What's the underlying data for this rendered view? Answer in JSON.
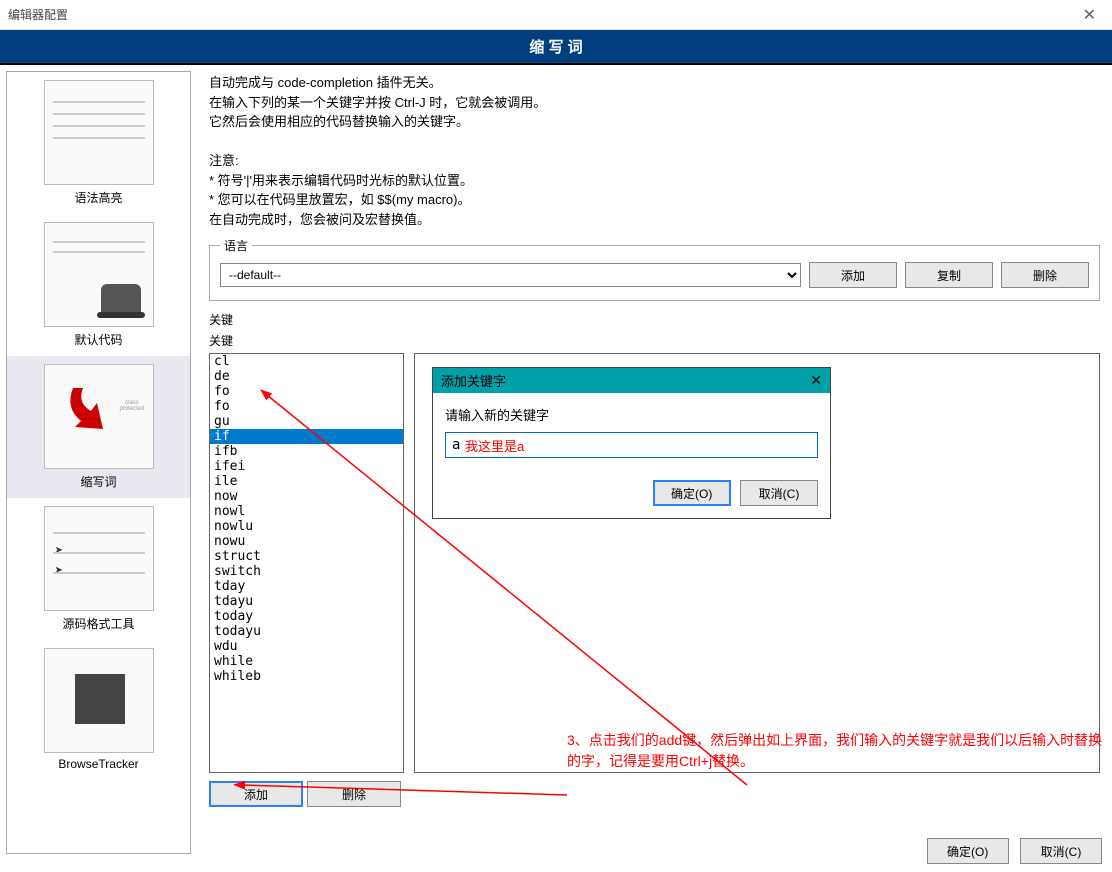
{
  "window": {
    "title": "编辑器配置"
  },
  "banner": "缩 写 词",
  "sidebar": {
    "items": [
      {
        "label": "语法高亮"
      },
      {
        "label": "默认代码"
      },
      {
        "label": "缩写词"
      },
      {
        "label": "源码格式工具"
      },
      {
        "label": "BrowseTracker"
      }
    ]
  },
  "description": {
    "line1": "自动完成与 code-completion 插件无关。",
    "line2": "在输入下列的某一个关键字并按 Ctrl-J 时，它就会被调用。",
    "line3": "它然后会使用相应的代码替换输入的关键字。",
    "note_h": "注意:",
    "note1": "* 符号'|'用来表示编辑代码时光标的默认位置。",
    "note2": "* 您可以在代码里放置宏，如 $$(my macro)。",
    "note3": "  在自动完成时，您会被问及宏替换值。"
  },
  "lang": {
    "legend": "语言",
    "value": "--default--",
    "add": "添加",
    "copy": "复制",
    "del": "删除"
  },
  "keywords": {
    "legend": "关键",
    "code_legend": "关键",
    "items": [
      "cl",
      "de",
      "fo",
      "fo",
      "gu",
      "if",
      "ifb",
      "ifei",
      "ile",
      "now",
      "nowl",
      "nowlu",
      "nowu",
      "struct",
      "switch",
      "tday",
      "tdayu",
      "today",
      "todayu",
      "wdu",
      "while",
      "whileb"
    ],
    "selected": "if",
    "add": "添加",
    "del": "删除"
  },
  "modal": {
    "title": "添加关键字",
    "label": "请输入新的关键字",
    "value": "a",
    "hint": "我这里是a",
    "ok": "确定(O)",
    "cancel": "取消(C)"
  },
  "annot": {
    "text": "3、点击我们的add键，然后弹出如上界面，我们输入的关键字就是我们以后输入时替换的字，记得是要用Ctrl+j替换。"
  },
  "footer": {
    "ok": "确定(O)",
    "cancel": "取消(C)"
  }
}
